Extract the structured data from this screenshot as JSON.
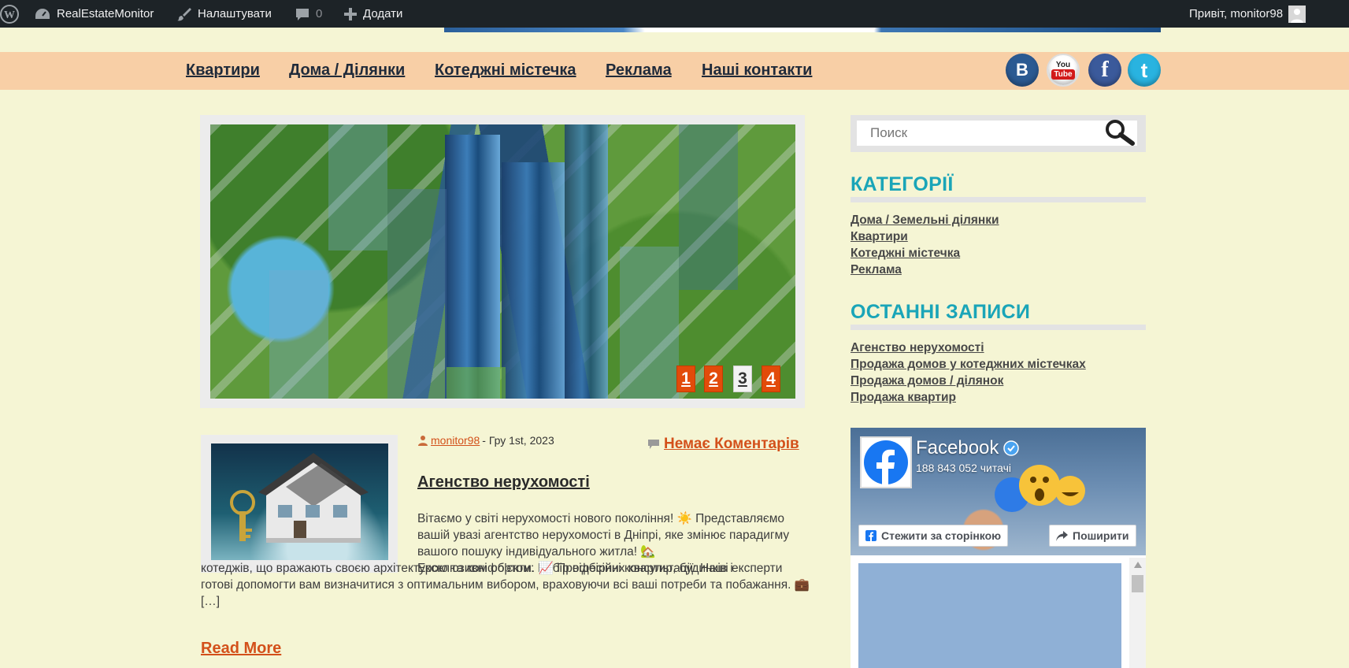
{
  "adminbar": {
    "site_name": "RealEstateMonitor",
    "customize_label": "Налаштувати",
    "comments_count": "0",
    "new_label": "Додати",
    "greeting": "Привіт, monitor98"
  },
  "nav": {
    "items": [
      "Квартири",
      "Дома / Ділянки",
      "Котеджні містечка",
      "Реклама",
      "Наші контакти"
    ]
  },
  "social": {
    "vk": "B",
    "youtube_top": "You",
    "youtube_bottom": "Tube",
    "facebook": "f",
    "twitter": "t"
  },
  "slider": {
    "pages": [
      "1",
      "2",
      "3",
      "4"
    ],
    "active_page": "3"
  },
  "post": {
    "author": "monitor98",
    "date": "- Гру 1st, 2023",
    "comments_link": "Немає Коментарів",
    "title": "Агенство нерухомості",
    "excerpt_1": "Вітаємо у світі нерухомості нового покоління! ☀️ Представляємо вашій увазі агентство нерухомості в Дніпрі, яке змінює парадигму вашого пошуку індивідуального житла! 🏡",
    "excerpt_1b": "Ексклюзивні об'єкти: Вибір відбірних квартир, будинків і",
    "excerpt_2": "котеджів, що вражають своєю архітектурою та комфортом. 📈 Професійні консультації: Наші експерти готові допомогти вам визначитися з оптимальним вибором, враховуючи всі ваші потреби та побажання. 💼 […]",
    "read_more": "Read More"
  },
  "sidebar": {
    "search_placeholder": "Поиск",
    "categories_title": "КАТЕГОРІЇ",
    "categories": [
      "Дома / Земельні ділянки",
      "Квартири",
      "Котеджні містечка",
      "Реклама"
    ],
    "recent_title": "ОСТАННІ ЗАПИСИ",
    "recent": [
      "Агенство нерухомості",
      "Продажа домов у котеджних містечках",
      "Продажа домов / ділянок",
      "Продажа квартир"
    ]
  },
  "facebook_widget": {
    "page_name": "Facebook",
    "followers": "188 843 052 читачі",
    "follow_label": "Стежити за сторінкою",
    "share_label": "Поширити"
  },
  "colors": {
    "accent_orange": "#d3501a",
    "heading_teal": "#1aa5b8",
    "nav_bg": "#f8cfa6",
    "page_bg": "#f5f5d4"
  }
}
